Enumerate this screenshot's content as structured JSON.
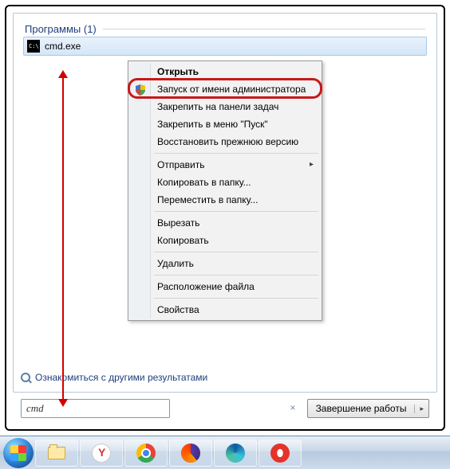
{
  "section": {
    "title": "Программы",
    "count": "(1)"
  },
  "result": {
    "label": "cmd.exe"
  },
  "context_menu": {
    "open": "Открыть",
    "run_as_admin": "Запуск от имени администратора",
    "pin_taskbar": "Закрепить на панели задач",
    "pin_start": "Закрепить в меню \"Пуск\"",
    "restore_prev": "Восстановить прежнюю версию",
    "send_to": "Отправить",
    "copy_to_folder": "Копировать в папку...",
    "move_to_folder": "Переместить в папку...",
    "cut": "Вырезать",
    "copy": "Копировать",
    "delete": "Удалить",
    "file_location": "Расположение файла",
    "properties": "Свойства"
  },
  "more_results_link": "Ознакомиться с другими результатами",
  "search": {
    "value": "cmd",
    "clear": "×"
  },
  "shutdown": {
    "label": "Завершение работы",
    "arrow": "▸"
  },
  "taskbar_icons": [
    "start",
    "explorer",
    "yandex",
    "chrome",
    "firefox",
    "edge",
    "opera"
  ]
}
